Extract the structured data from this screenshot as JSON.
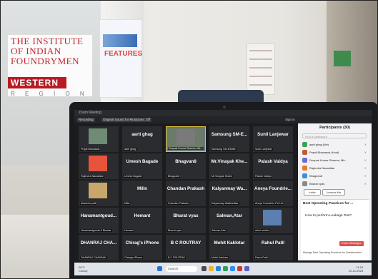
{
  "scene": {
    "sign_lines": [
      "THE INSTITUTE",
      "OF INDIAN",
      "FOUNDRYMEN"
    ],
    "sign_band": "WESTERN",
    "sign_sub": "R E G I O N",
    "banner_text": "FEATURES"
  },
  "window": {
    "title": "Zoom Meeting",
    "recording_label": "Recording",
    "sound_label": "Original Sound for Musicians: Off",
    "sign_in": "Sign in"
  },
  "tiles": [
    {
      "name": "",
      "label": "Prapti Bhanawat"
    },
    {
      "name": "aarti ghag",
      "label": "aarti ghag"
    },
    {
      "name": "",
      "label": "Deepak Kumar Sharma, Mfr...",
      "active": true
    },
    {
      "name": "Samsung SM-E...",
      "label": "Samsung SM-E346B"
    },
    {
      "name": "Sunil Lanjewar",
      "label": "Sunil Lanjewar"
    },
    {
      "name": "",
      "label": "Rajendra Nawadkar"
    },
    {
      "name": "Umesh Bagade",
      "label": "Umesh Bagade"
    },
    {
      "name": "Bhagvan8",
      "label": "Bhagvan8"
    },
    {
      "name": "Mr.Vinayak Khe...",
      "label": "Mr.Vinayak Khaire"
    },
    {
      "name": "Palash Vaidya",
      "label": "Palash Vaidya"
    },
    {
      "name": "",
      "label": "dhanesh patil"
    },
    {
      "name": "Milin",
      "label": "Milin"
    },
    {
      "name": "Chandan Prakash",
      "label": "Chandan Prakash"
    },
    {
      "name": "Kalyanmay Wa...",
      "label": "Kalyanmay Waikhedkar"
    },
    {
      "name": "Aneya Foundrie...",
      "label": "Aneya Foundries Pvt Ltd"
    },
    {
      "name": "Hanamantgoud...",
      "label": "Hanamantgouda K Biradar"
    },
    {
      "name": "Hemant",
      "label": "Hemant"
    },
    {
      "name": "Bharat vyas",
      "label": "Bharat vyas"
    },
    {
      "name": "Salman,Atar",
      "label": "Salman,Atar"
    },
    {
      "name": "",
      "label": "rahul mehta"
    },
    {
      "name": "DHANRAJ CHA...",
      "label": "DHANRAJ CHANDAK"
    },
    {
      "name": "Chirag's iPhone",
      "label": "Chirag's iPhone"
    },
    {
      "name": "B C ROUTRAY",
      "label": "B C ROUTRAY"
    },
    {
      "name": "Mohit Kaklotar",
      "label": "Mohit Kaklotar"
    },
    {
      "name": "Rahul Patil",
      "label": "Rahul Patil"
    }
  ],
  "participants": {
    "title": "Participants (30)",
    "search_placeholder": "Find a participant",
    "rows": [
      {
        "name": "aarti ghag (Me)"
      },
      {
        "name": "Prapti Bhanawat (Host)"
      },
      {
        "name": "Deepak Kumar Sharma, Mfr..."
      },
      {
        "name": "Rajendra Nawadkar"
      },
      {
        "name": "Bhagvan8"
      },
      {
        "name": "Bharat vyas"
      }
    ],
    "invite_label": "Invite",
    "unmute_label": "Unmute Me"
  },
  "qa": {
    "heading": "Best Operating Practices for ...",
    "question": "How to perform Leakage Test?",
    "send_label": "Enter Messages",
    "footer": "Manage Best Operating Practices for Questionaires"
  },
  "taskbar": {
    "search_label": "Search",
    "weather": "26°C",
    "weather_sub": "Cloudy",
    "time": "11:24",
    "date": "20-11-2024"
  },
  "colors": {
    "sign_red": "#c0262e",
    "active_tile_border": "#e2c33a",
    "send_button": "#d9534f"
  }
}
